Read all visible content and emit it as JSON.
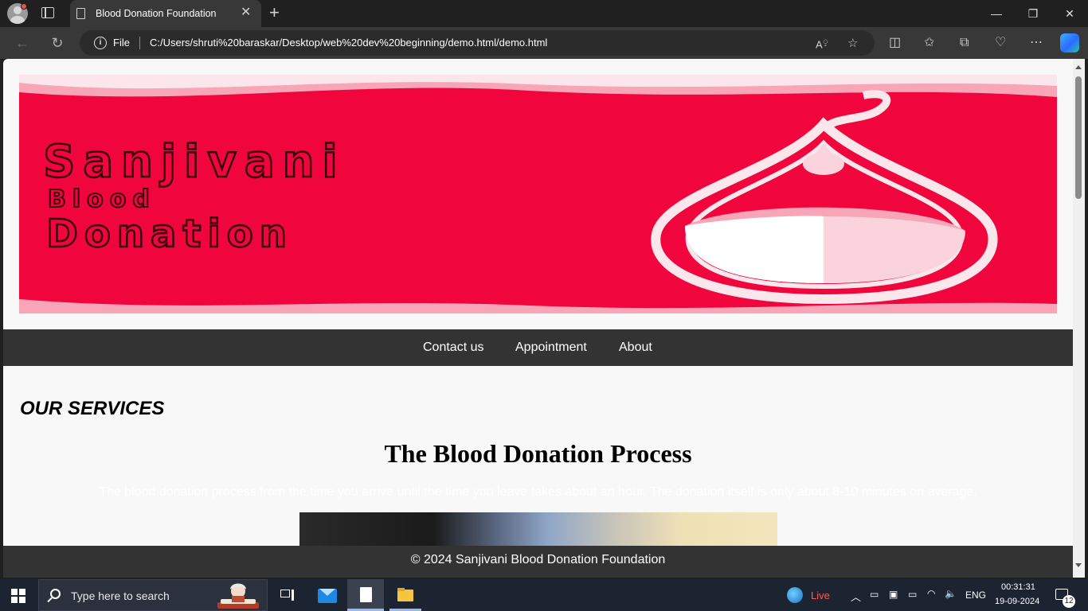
{
  "browser": {
    "tab_title": "Blood Donation Foundation",
    "address_scheme": "File",
    "address_url": "C:/Users/shruti%20baraskar/Desktop/web%20dev%20beginning/demo.html/demo.html"
  },
  "page": {
    "banner": {
      "line1": "Sanjivani",
      "line2": "Blood",
      "line3": "Donation"
    },
    "nav": [
      "Contact us",
      "Appointment",
      "About"
    ],
    "services_heading": "OUR SERVICES",
    "process_title": "The Blood Donation Process",
    "process_text": "The blood donation process from the time you arrive until the time you leave takes about an hour. The donation itself is only about 8-10 minutes on average.",
    "footer": "© 2024 Sanjivani Blood Donation Foundation"
  },
  "taskbar": {
    "search_placeholder": "Type here to search",
    "weather_label": "Live",
    "language": "ENG",
    "time": "00:31:31",
    "date": "19-09-2024",
    "notification_count": "12"
  },
  "colors": {
    "banner_red": "#f0063c",
    "nav_bg": "#333333",
    "page_bg": "#f8f8f8"
  }
}
